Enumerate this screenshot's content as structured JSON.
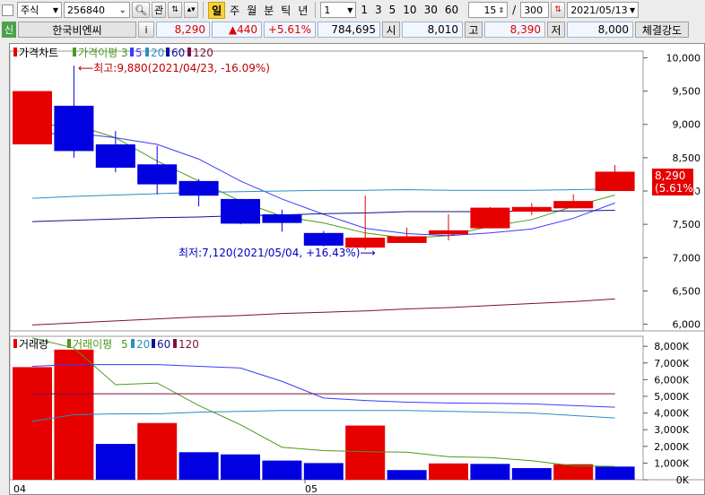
{
  "toolbar": {
    "market_select": "주식",
    "code": "256840",
    "btn_related": "관",
    "periods": [
      "일",
      "주",
      "월",
      "분",
      "틱",
      "년"
    ],
    "active_period": "일",
    "interval_value": "1",
    "quick_intervals": [
      "1",
      "3",
      "5",
      "10",
      "30",
      "60"
    ],
    "zoom_value": "15",
    "slash": "/",
    "count_value": "300",
    "date_value": "2021/05/13"
  },
  "info": {
    "badge": "신",
    "name": "한국비엔씨",
    "info_btn": "i",
    "price": "8,290",
    "change": "▲440",
    "change_pct": "+5.61%",
    "volume": "784,695",
    "open_label": "시",
    "open": "8,010",
    "high_label": "고",
    "high": "8,390",
    "low_label": "저",
    "low": "8,000",
    "strength_button": "체결강도"
  },
  "colors": {
    "up": "#e60000",
    "down": "#0000e0",
    "ma3": "#4a9a1c",
    "ma5": "#3a3aff",
    "ma20": "#2a8fbf",
    "ma60": "#101090",
    "ma120": "#7a1040"
  },
  "price_legend": {
    "title": "가격차트",
    "ma_label": "가격이평",
    "items": [
      "3",
      "5",
      "20",
      "60",
      "120"
    ]
  },
  "volume_legend": {
    "title": "거래량",
    "ma_label": "거래이평",
    "items": [
      "5",
      "20",
      "60",
      "120"
    ]
  },
  "annotations": {
    "high": "최고:9,880(2021/04/23, -16.09%)",
    "low": "최저:7,120(2021/05/04, +16.43%)",
    "last_price": "8,290",
    "last_pct": "(5.61%)"
  },
  "x_axis": {
    "labels": [
      "04",
      "05"
    ]
  },
  "chart_data": [
    {
      "type": "candlestick",
      "y_ticks": [
        "10,000",
        "9,500",
        "9,000",
        "8,500",
        "8,000",
        "7,500",
        "7,000",
        "6,500",
        "6,000"
      ],
      "ylim": [
        5900,
        10100
      ],
      "candles": [
        {
          "o": 8700,
          "h": 9500,
          "l": 8700,
          "c": 9500
        },
        {
          "o": 9280,
          "h": 9880,
          "l": 8500,
          "c": 8600
        },
        {
          "o": 8700,
          "h": 8900,
          "l": 8280,
          "c": 8350
        },
        {
          "o": 8400,
          "h": 8680,
          "l": 7950,
          "c": 8100
        },
        {
          "o": 8150,
          "h": 8180,
          "l": 7770,
          "c": 7930
        },
        {
          "o": 7880,
          "h": 7880,
          "l": 7500,
          "c": 7510
        },
        {
          "o": 7650,
          "h": 7720,
          "l": 7390,
          "c": 7520
        },
        {
          "o": 7370,
          "h": 7400,
          "l": 7170,
          "c": 7180
        },
        {
          "o": 7150,
          "h": 7930,
          "l": 7120,
          "c": 7300
        },
        {
          "o": 7220,
          "h": 7450,
          "l": 7220,
          "c": 7320
        },
        {
          "o": 7350,
          "h": 7650,
          "l": 7260,
          "c": 7410
        },
        {
          "o": 7440,
          "h": 7760,
          "l": 7440,
          "c": 7750
        },
        {
          "o": 7690,
          "h": 7820,
          "l": 7640,
          "c": 7760
        },
        {
          "o": 7740,
          "h": 7950,
          "l": 7740,
          "c": 7850
        },
        {
          "o": 8000,
          "h": 8390,
          "l": 8000,
          "c": 8290
        }
      ],
      "ma": {
        "3": [
          8980,
          9000,
          8800,
          8450,
          8150,
          7850,
          7620,
          7520,
          7370,
          7290,
          7330,
          7470,
          7570,
          7770,
          7940
        ],
        "5": [
          8850,
          8870,
          8800,
          8700,
          8480,
          8150,
          7880,
          7650,
          7440,
          7360,
          7330,
          7370,
          7430,
          7590,
          7820
        ],
        "20": [
          7890,
          7920,
          7940,
          7960,
          7980,
          7990,
          8000,
          8010,
          8010,
          8020,
          8010,
          8010,
          8010,
          8020,
          8030
        ],
        "60": [
          7540,
          7560,
          7580,
          7600,
          7610,
          7630,
          7640,
          7660,
          7670,
          7690,
          7690,
          7690,
          7700,
          7700,
          7710
        ],
        "120": [
          5990,
          6020,
          6050,
          6080,
          6110,
          6130,
          6160,
          6180,
          6200,
          6230,
          6250,
          6280,
          6310,
          6340,
          6380
        ]
      }
    },
    {
      "type": "bar",
      "y_ticks": [
        "8,000K",
        "7,000K",
        "6,000K",
        "5,000K",
        "4,000K",
        "3,000K",
        "2,000K",
        "1,000K",
        "0K"
      ],
      "ylim": [
        0,
        8600
      ],
      "values": [
        6750,
        7800,
        2150,
        3400,
        1650,
        1520,
        1150,
        1000,
        3250,
        580,
        980,
        950,
        700,
        930,
        790
      ],
      "up": [
        true,
        true,
        false,
        true,
        false,
        false,
        false,
        false,
        true,
        false,
        true,
        false,
        false,
        true,
        false
      ],
      "ma": {
        "5": [
          8500,
          7900,
          5700,
          5800,
          4450,
          3300,
          1950,
          1750,
          1680,
          1650,
          1380,
          1330,
          1140,
          840,
          800
        ],
        "20": [
          6800,
          6900,
          6900,
          6900,
          6800,
          6700,
          5900,
          4900,
          4750,
          4650,
          4600,
          4580,
          4550,
          4450,
          4350
        ],
        "60": [
          5150,
          5150,
          5150,
          5150,
          5150,
          5150,
          5150,
          5150,
          5150,
          5150,
          5150,
          5150,
          5150,
          5150,
          5150
        ],
        "120": [
          3500,
          3900,
          3950,
          3950,
          4050,
          4100,
          4150,
          4150,
          4150,
          4150,
          4100,
          4050,
          4000,
          3850,
          3700
        ]
      }
    }
  ]
}
